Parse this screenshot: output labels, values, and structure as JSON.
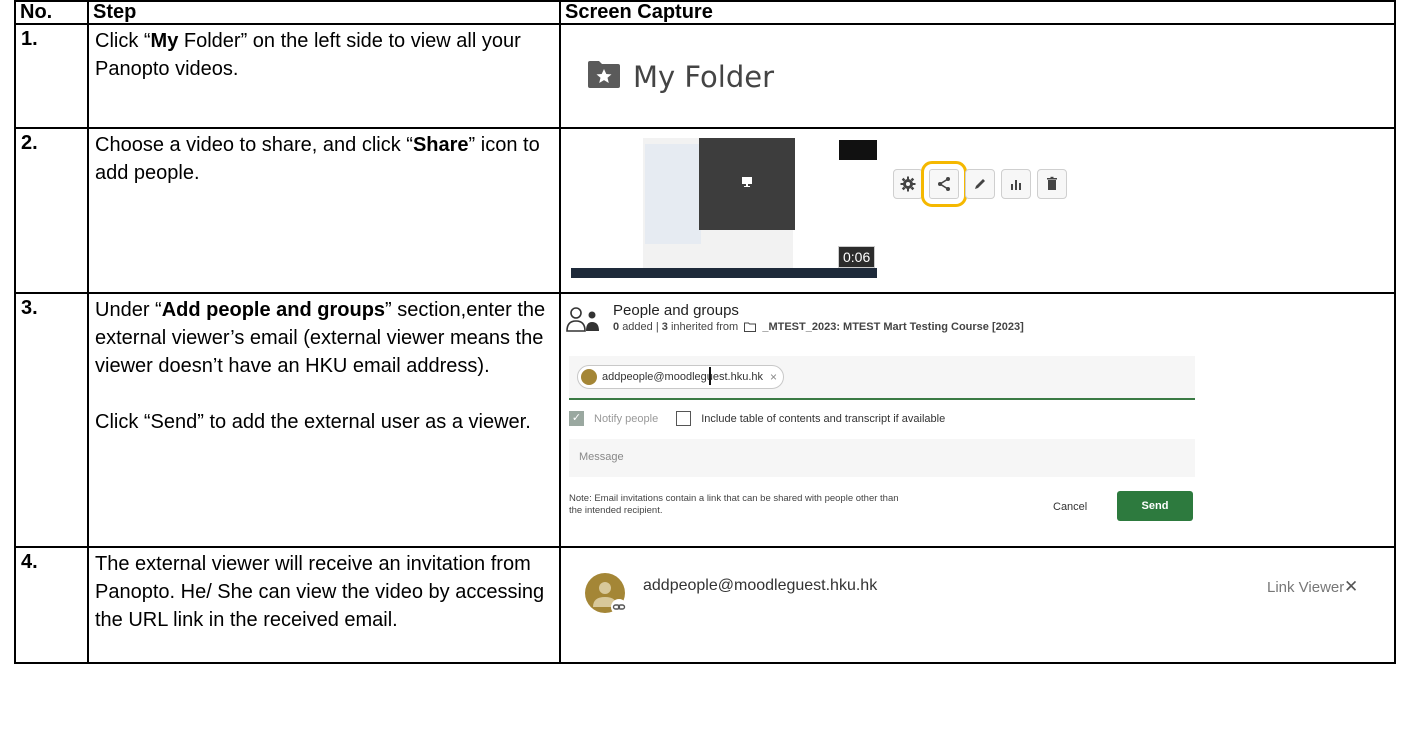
{
  "headers": {
    "no": "No.",
    "step": "Step",
    "capture": "Screen Capture"
  },
  "rows": [
    {
      "num": "1.",
      "text": [
        {
          "t": "Click “",
          "b": false
        },
        {
          "t": "My",
          "b": true
        },
        {
          "t": " Folder” on the left side to view all your Panopto videos.",
          "b": false
        }
      ]
    },
    {
      "num": "2.",
      "text": [
        {
          "t": "Choose a video to share, and click “",
          "b": false
        },
        {
          "t": "Share",
          "b": true
        },
        {
          "t": "” icon to add people.",
          "b": false
        }
      ]
    },
    {
      "num": "3.",
      "text": [
        {
          "t": "Under “",
          "b": false
        },
        {
          "t": "Add people and groups",
          "b": true
        },
        {
          "t": "” section,enter the external viewer’s email (external viewer means the viewer doesn’t have an HKU email address).",
          "b": false
        },
        {
          "t": "\n\nClick “Send” to add the external user as a viewer.",
          "b": false
        }
      ]
    },
    {
      "num": "4.",
      "text": [
        {
          "t": "The external viewer will receive an invitation from Panopto. He/ She can view the video by accessing the URL link in the received email.",
          "b": false
        }
      ]
    }
  ],
  "capture1": {
    "folder_label": "My Folder",
    "icon": "star-folder-icon"
  },
  "capture2": {
    "duration": "0:06",
    "tools": [
      "settings-icon",
      "share-icon",
      "edit-icon",
      "stats-icon",
      "delete-icon"
    ],
    "highlight_color": "#f5b800"
  },
  "capture3": {
    "title": "People and groups",
    "added_count": "0",
    "added_label": "added",
    "separator": "|",
    "inherited_count": "3",
    "inherited_label": "inherited from",
    "course": "_MTEST_2023: MTEST Mart Testing Course [2023]",
    "email_chip": "addpeople@moodleguest.hku.hk",
    "notify_label": "Notify people",
    "include_label": "Include table of contents and transcript if available",
    "message_placeholder": "Message",
    "note": "Note: Email invitations contain a link that can be shared with people other than the intended recipient.",
    "cancel_label": "Cancel",
    "send_label": "Send",
    "accent_color": "#2d7a3e"
  },
  "capture4": {
    "email": "addpeople@moodleguest.hku.hk",
    "role": "Link Viewer",
    "close": "✕"
  }
}
